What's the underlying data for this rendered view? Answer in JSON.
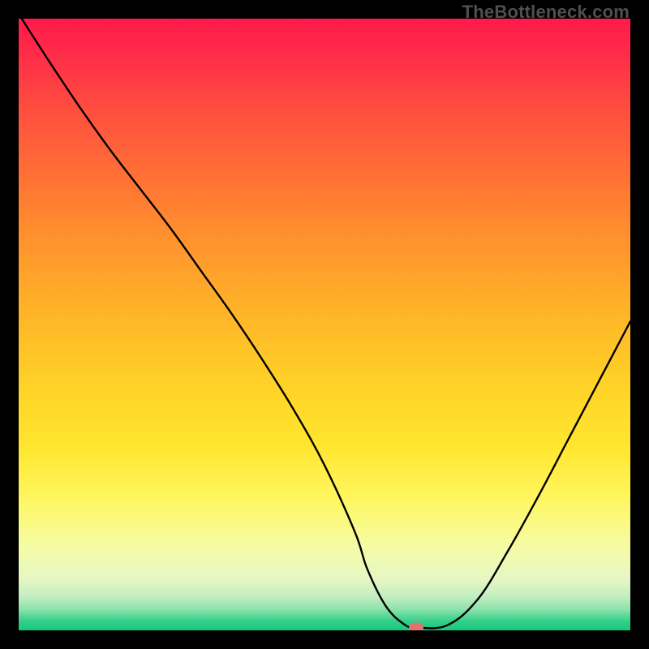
{
  "watermark": "TheBottleneck.com",
  "chart_data": {
    "type": "line",
    "title": "",
    "xlabel": "",
    "ylabel": "",
    "xlim": [
      0,
      100
    ],
    "ylim": [
      0,
      100
    ],
    "grid": false,
    "legend": false,
    "x": [
      0.5,
      5,
      10,
      15,
      20,
      25,
      30,
      35,
      40,
      45,
      50,
      55,
      57,
      60,
      63,
      65,
      70,
      75,
      80,
      85,
      90,
      95,
      100
    ],
    "bottleneck_pct": [
      100,
      93,
      85.5,
      78.5,
      72,
      65.5,
      58.5,
      51.5,
      44,
      36,
      27,
      16,
      10,
      4,
      1,
      0.5,
      0.8,
      5,
      13,
      22,
      31.5,
      41,
      50.5
    ],
    "marker": {
      "x": 65,
      "y": 0.5,
      "color": "#e2736c",
      "rx": 9,
      "ry": 6
    },
    "gradient_stops": [
      {
        "offset": 0,
        "color": "#ff1a4b"
      },
      {
        "offset": 0.06,
        "color": "#ff2d49"
      },
      {
        "offset": 0.14,
        "color": "#ff4b3f"
      },
      {
        "offset": 0.25,
        "color": "#ff6e36"
      },
      {
        "offset": 0.35,
        "color": "#ff8f2e"
      },
      {
        "offset": 0.48,
        "color": "#ffb428"
      },
      {
        "offset": 0.6,
        "color": "#ffd227"
      },
      {
        "offset": 0.7,
        "color": "#ffe62f"
      },
      {
        "offset": 0.78,
        "color": "#fff65d"
      },
      {
        "offset": 0.86,
        "color": "#f6fca2"
      },
      {
        "offset": 0.915,
        "color": "#e7f7c4"
      },
      {
        "offset": 0.945,
        "color": "#c3eec1"
      },
      {
        "offset": 0.965,
        "color": "#8de3ac"
      },
      {
        "offset": 0.985,
        "color": "#34cf8a"
      },
      {
        "offset": 1.0,
        "color": "#12c97d"
      }
    ]
  }
}
